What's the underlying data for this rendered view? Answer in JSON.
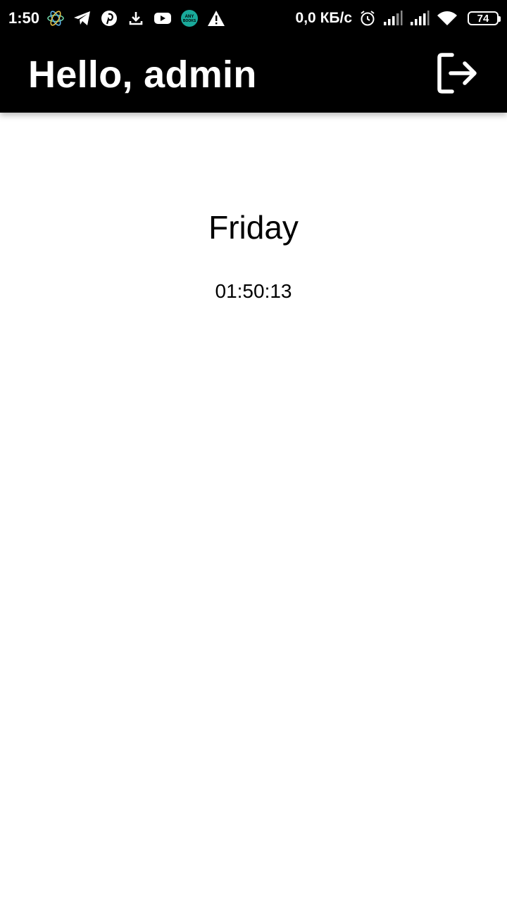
{
  "status_bar": {
    "time": "1:50",
    "net_speed": "0,0 КБ/с",
    "battery": "74",
    "notification_icons": [
      "atom-icon",
      "telegram-icon",
      "pinterest-icon",
      "download-icon",
      "youtube-icon",
      "anybooks-icon",
      "warning-icon"
    ],
    "anybooks_text": "ANY BOOKS",
    "system_icons": [
      "alarm-icon",
      "signal-icon",
      "signal-icon",
      "wifi-icon",
      "battery-icon"
    ]
  },
  "app_bar": {
    "title": "Hello, admin",
    "logout_icon": "logout-icon",
    "background": "#000000",
    "text_color": "#ffffff"
  },
  "main": {
    "day": "Friday",
    "time": "01:50:13"
  }
}
